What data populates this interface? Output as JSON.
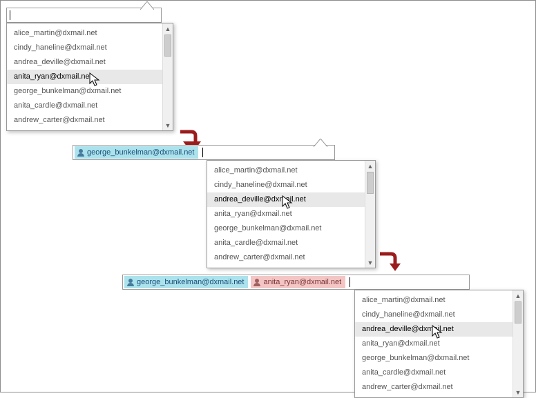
{
  "suggestions": [
    "alice_martin@dxmail.net",
    "cindy_haneline@dxmail.net",
    "andrea_deville@dxmail.net",
    "anita_ryan@dxmail.net",
    "george_bunkelman@dxmail.net",
    "anita_cardle@dxmail.net",
    "andrew_carter@dxmail.net"
  ],
  "stage1": {
    "tokens": [],
    "highlight_index": 3
  },
  "stage2": {
    "tokens": [
      {
        "text": "george_bunkelman@dxmail.net",
        "color": "blue"
      }
    ],
    "highlight_index": 2
  },
  "stage3": {
    "tokens": [
      {
        "text": "george_bunkelman@dxmail.net",
        "color": "blue"
      },
      {
        "text": "anita_ryan@dxmail.net",
        "color": "pink"
      }
    ],
    "highlight_index": 2
  }
}
